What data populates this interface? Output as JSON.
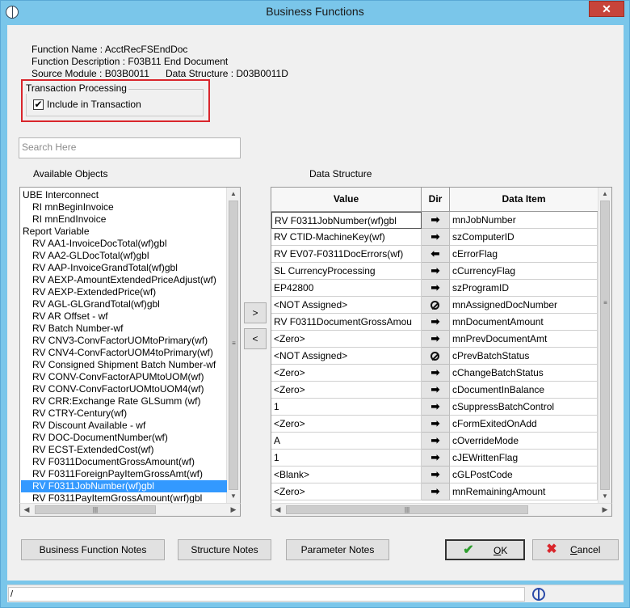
{
  "window": {
    "title": "Business Functions",
    "close_glyph": "✕"
  },
  "info": {
    "function_name": "Function Name : AcctRecFSEndDoc",
    "function_description": "Function Description : F03B11 End Document",
    "source_module": "Source Module : B03B0011",
    "data_structure": "Data Structure : D03B0011D"
  },
  "transaction_processing": {
    "legend": "Transaction Processing",
    "checkbox_label": "Include in Transaction",
    "checked": true
  },
  "search": {
    "placeholder": "Search Here"
  },
  "available_objects": {
    "label": "Available Objects",
    "items": [
      {
        "text": "UBE Interconnect",
        "indent": false,
        "selected": false
      },
      {
        "text": "RI  mnBeginInvoice",
        "indent": true,
        "selected": false
      },
      {
        "text": "RI  mnEndInvoice",
        "indent": true,
        "selected": false
      },
      {
        "text": "Report Variable",
        "indent": false,
        "selected": false
      },
      {
        "text": "RV  AA1-InvoiceDocTotal(wf)gbl",
        "indent": true,
        "selected": false
      },
      {
        "text": "RV  AA2-GLDocTotal(wf)gbl",
        "indent": true,
        "selected": false
      },
      {
        "text": "RV  AAP-InvoiceGrandTotal(wf)gbl",
        "indent": true,
        "selected": false
      },
      {
        "text": "RV  AEXP-AmountExtendedPriceAdjust(wf)",
        "indent": true,
        "selected": false
      },
      {
        "text": "RV  AEXP-ExtendedPrice(wf)",
        "indent": true,
        "selected": false
      },
      {
        "text": "RV  AGL-GLGrandTotal(wf)gbl",
        "indent": true,
        "selected": false
      },
      {
        "text": "RV  AR Offset - wf",
        "indent": true,
        "selected": false
      },
      {
        "text": "RV  Batch Number-wf",
        "indent": true,
        "selected": false
      },
      {
        "text": "RV  CNV3-ConvFactorUOMtoPrimary(wf)",
        "indent": true,
        "selected": false
      },
      {
        "text": "RV  CNV4-ConvFactorUOM4toPrimary(wf)",
        "indent": true,
        "selected": false
      },
      {
        "text": "RV  Consigned Shipment Batch Number-wf",
        "indent": true,
        "selected": false
      },
      {
        "text": "RV  CONV-ConvFactorAPUMtoUOM(wf)",
        "indent": true,
        "selected": false
      },
      {
        "text": "RV  CONV-ConvFactorUOMtoUOM4(wf)",
        "indent": true,
        "selected": false
      },
      {
        "text": "RV  CRR:Exchange Rate GLSumm (wf)",
        "indent": true,
        "selected": false
      },
      {
        "text": "RV  CTRY-Century(wf)",
        "indent": true,
        "selected": false
      },
      {
        "text": "RV  Discount Available - wf",
        "indent": true,
        "selected": false
      },
      {
        "text": "RV  DOC-DocumentNumber(wf)",
        "indent": true,
        "selected": false
      },
      {
        "text": "RV  ECST-ExtendedCost(wf)",
        "indent": true,
        "selected": false
      },
      {
        "text": "RV  F0311DocumentGrossAmount(wf)",
        "indent": true,
        "selected": false
      },
      {
        "text": "RV  F0311ForeignPayItemGrossAmt(wf)",
        "indent": true,
        "selected": false
      },
      {
        "text": "RV  F0311JobNumber(wf)gbl",
        "indent": true,
        "selected": true
      },
      {
        "text": "RV  F0311PayItemGrossAmount(wrf)gbl",
        "indent": true,
        "selected": false
      }
    ]
  },
  "move_buttons": {
    "add": ">",
    "remove": "<"
  },
  "data_structure": {
    "label": "Data Structure",
    "headers": {
      "value": "Value",
      "dir": "Dir",
      "item": "Data Item"
    },
    "rows": [
      {
        "value": "RV F0311JobNumber(wf)gbl",
        "dir": "in",
        "item": "mnJobNumber"
      },
      {
        "value": "RV CTID-MachineKey(wf)",
        "dir": "in",
        "item": "szComputerID"
      },
      {
        "value": "RV EV07-F0311DocErrors(wf)",
        "dir": "out",
        "item": "cErrorFlag"
      },
      {
        "value": "SL CurrencyProcessing",
        "dir": "in",
        "item": "cCurrencyFlag"
      },
      {
        "value": "EP42800",
        "dir": "in",
        "item": "szProgramID"
      },
      {
        "value": "<NOT Assigned>",
        "dir": "none",
        "item": "mnAssignedDocNumber"
      },
      {
        "value": "RV F0311DocumentGrossAmou",
        "dir": "in",
        "item": "mnDocumentAmount"
      },
      {
        "value": "<Zero>",
        "dir": "in",
        "item": "mnPrevDocumentAmt"
      },
      {
        "value": "<NOT Assigned>",
        "dir": "none",
        "item": "cPrevBatchStatus"
      },
      {
        "value": "<Zero>",
        "dir": "in",
        "item": "cChangeBatchStatus"
      },
      {
        "value": "<Zero>",
        "dir": "in",
        "item": "cDocumentInBalance"
      },
      {
        "value": "1",
        "dir": "in",
        "item": "cSuppressBatchControl"
      },
      {
        "value": "<Zero>",
        "dir": "in",
        "item": "cFormExitedOnAdd"
      },
      {
        "value": "A",
        "dir": "in",
        "item": "cOverrideMode"
      },
      {
        "value": "1",
        "dir": "in",
        "item": "cJEWrittenFlag"
      },
      {
        "value": "<Blank>",
        "dir": "in",
        "item": "cGLPostCode"
      },
      {
        "value": "<Zero>",
        "dir": "in",
        "item": "mnRemainingAmount"
      }
    ]
  },
  "buttons": {
    "bf_notes": "Business Function Notes",
    "structure_notes": "Structure Notes",
    "parameter_notes": "Parameter Notes",
    "ok": "OK",
    "cancel": "Cancel"
  },
  "status": {
    "text": "/"
  },
  "colors": {
    "selection": "#3399ff",
    "highlight_border": "#d9262c",
    "ok_check": "#2e9e2e",
    "cancel_x": "#d9262c"
  }
}
